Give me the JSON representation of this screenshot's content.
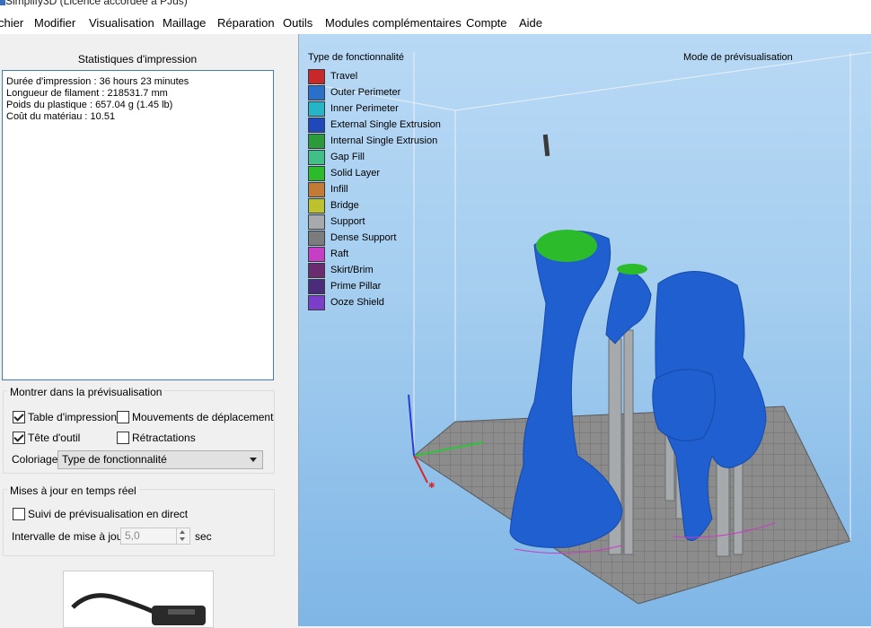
{
  "window": {
    "title": "Simplify3D (Licence accordée à PJus)"
  },
  "menu": [
    "chier",
    "Modifier",
    "Visualisation",
    "Maillage",
    "Réparation",
    "Outils",
    "Modules complémentaires",
    "Compte",
    "Aide"
  ],
  "stats": {
    "title": "Statistiques d'impression",
    "lines": [
      "Durée d'impression : 36 hours 23 minutes",
      "Longueur de filament : 218531.7 mm",
      "Poids du plastique : 657.04 g (1.45 lb)",
      "Coût du matériau : 10.51"
    ]
  },
  "preview_options": {
    "title": "Montrer dans la prévisualisation",
    "build_table": {
      "label": "Table d'impression",
      "checked": true
    },
    "travel_moves": {
      "label": "Mouvements de déplacement",
      "checked": false
    },
    "toolhead": {
      "label": "Tête d'outil",
      "checked": true
    },
    "retractions": {
      "label": "Rétractations",
      "checked": false
    },
    "coloring_label": "Coloriage",
    "coloring_value": "Type de fonctionnalité"
  },
  "realtime": {
    "title": "Mises à jour en temps réel",
    "follow": {
      "label": "Suivi de prévisualisation en direct",
      "checked": false
    },
    "interval_label": "Intervalle de mise à jour",
    "interval_value": "5,0",
    "interval_unit": "sec"
  },
  "viewport": {
    "legend_title": "Type de fonctionnalité",
    "mode_label": "Mode de prévisualisation",
    "legend": [
      {
        "label": "Travel",
        "color": "#c8282a"
      },
      {
        "label": "Outer Perimeter",
        "color": "#2a6fc9"
      },
      {
        "label": "Inner Perimeter",
        "color": "#26b5c6"
      },
      {
        "label": "External Single Extrusion",
        "color": "#1f49bb"
      },
      {
        "label": "Internal Single Extrusion",
        "color": "#2a9a3a"
      },
      {
        "label": "Gap Fill",
        "color": "#42bf86"
      },
      {
        "label": "Solid Layer",
        "color": "#2bbb2b"
      },
      {
        "label": "Infill",
        "color": "#c27a37"
      },
      {
        "label": "Bridge",
        "color": "#bcc22e"
      },
      {
        "label": "Support",
        "color": "#a7aaad"
      },
      {
        "label": "Dense Support",
        "color": "#7a7c7e"
      },
      {
        "label": "Raft",
        "color": "#c63ec6"
      },
      {
        "label": "Skirt/Brim",
        "color": "#6a2c6e"
      },
      {
        "label": "Prime Pillar",
        "color": "#4b2c7a"
      },
      {
        "label": "Ooze Shield",
        "color": "#7b3ec8"
      }
    ]
  }
}
